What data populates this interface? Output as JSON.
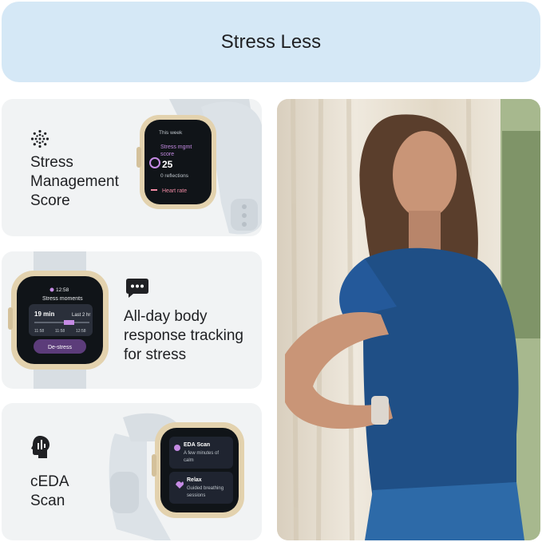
{
  "banner": {
    "title": "Stress Less"
  },
  "features": [
    {
      "label": "Stress\nManagement\nScore",
      "icon": "dotted-circle-icon",
      "watch": {
        "week_label": "This week",
        "metric_title_1": "Stress mgmt",
        "metric_title_2": "score",
        "score": "25",
        "reflections": "0 reflections",
        "heart_rate": "Heart rate"
      }
    },
    {
      "label": "All-day body\nresponse tracking\nfor stress",
      "icon": "chat-bubble-icon",
      "watch": {
        "time": "12:58",
        "title": "Stress moments",
        "duration": "19 min",
        "range": "Last 2 hr",
        "ticks": [
          "11:58",
          "11:58",
          "12:58"
        ],
        "button": "De-stress"
      }
    },
    {
      "label": "cEDA\nScan",
      "icon": "head-signal-icon",
      "watch": {
        "item1_title": "EDA Scan",
        "item1_sub_1": "A few minutes of",
        "item1_sub_2": "calm",
        "item2_title": "Relax",
        "item2_sub_1": "Guided breathing",
        "item2_sub_2": "sessions"
      }
    }
  ],
  "colors": {
    "banner_bg": "#d5e8f6",
    "card_bg": "#f1f3f4",
    "watch_case": "#e3d2ae",
    "watch_band": "#d8dee3",
    "accent_purple": "#c58be4"
  }
}
